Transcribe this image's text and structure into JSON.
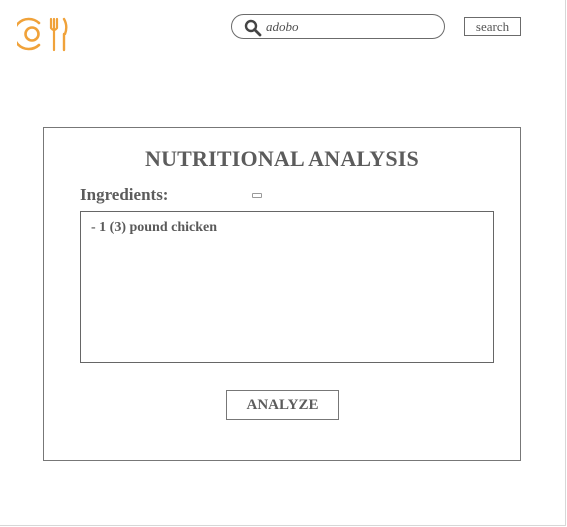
{
  "header": {
    "logo_icon": "plate-fork-knife-icon",
    "accent_color": "#f0a23a",
    "search": {
      "icon": "search-icon",
      "value": "adobo",
      "button_label": "search"
    }
  },
  "panel": {
    "title": "NUTRITIONAL ANALYSIS",
    "ingredients_label": "Ingredients:",
    "ingredients_text": "- 1 (3) pound chicken",
    "analyze_label": "ANALYZE"
  }
}
